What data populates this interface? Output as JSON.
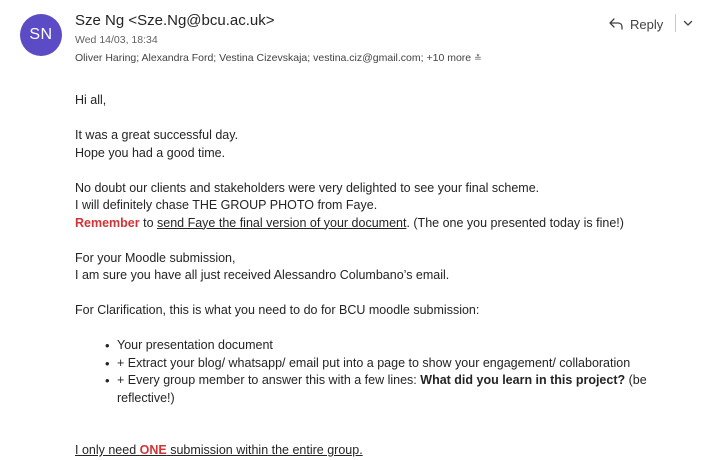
{
  "header": {
    "avatar_initials": "SN",
    "avatar_color": "#5b4bc4",
    "sender": "Sze Ng <Sze.Ng@bcu.ac.uk>",
    "date": "Wed 14/03, 18:34",
    "recipients": "Oliver Haring; Alexandra Ford; Vestina Cizevskaja; vestina.ciz@gmail.com;",
    "more": "+10 more",
    "reply_label": "Reply"
  },
  "body": {
    "greeting": "Hi all,",
    "p1_line1": "It was a great successful day.",
    "p1_line2": "Hope you had a good time.",
    "p2_line1": "No doubt our clients and stakeholders were very delighted to see your final scheme.",
    "p2_line2": "I will definitely chase THE GROUP PHOTO from Faye.",
    "p2_line3_red": "Remember",
    "p2_line3_to": " to ",
    "p2_line3_link": "send Faye the final version of your document",
    "p2_line3_rest": ". (The one you presented today is fine!)",
    "p3_line1": "For your Moodle submission,",
    "p3_line2": "I am sure you have all just received Alessandro Columbano’s email.",
    "p4_line1": "For Clarification, this is what you need to do for BCU moodle submission:",
    "bullets": [
      "Your presentation document",
      "+ Extract your blog/ whatsapp/ email put into a page to show your engagement/ collaboration",
      "+ Every group member to answer this with a few lines: "
    ],
    "bullet3_bold": "What did you learn in this project?",
    "bullet3_rest": "  (be reflective!)",
    "final_part1": "I only need ",
    "final_red": "ONE",
    "final_part2": " submission within the entire group."
  },
  "colors": {
    "accent_red": "#d13438",
    "text": "#242424"
  }
}
